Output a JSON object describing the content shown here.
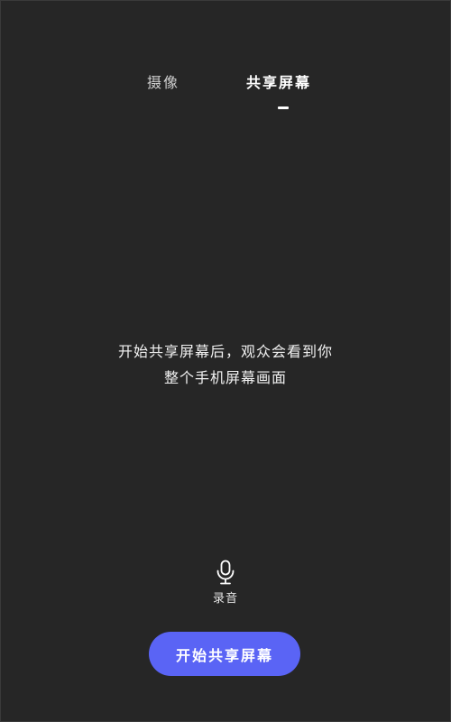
{
  "tabs": {
    "camera_label": "摄像",
    "screen_label": "共享屏幕",
    "active": "screen"
  },
  "message": {
    "line1": "开始共享屏幕后，观众会看到你",
    "line2": "整个手机屏幕画面"
  },
  "record": {
    "icon": "microphone-icon",
    "label": "录音"
  },
  "start_button": {
    "label": "开始共享屏幕",
    "color": "#5a64f5"
  },
  "colors": {
    "background": "#262626",
    "text": "#ffffff"
  }
}
